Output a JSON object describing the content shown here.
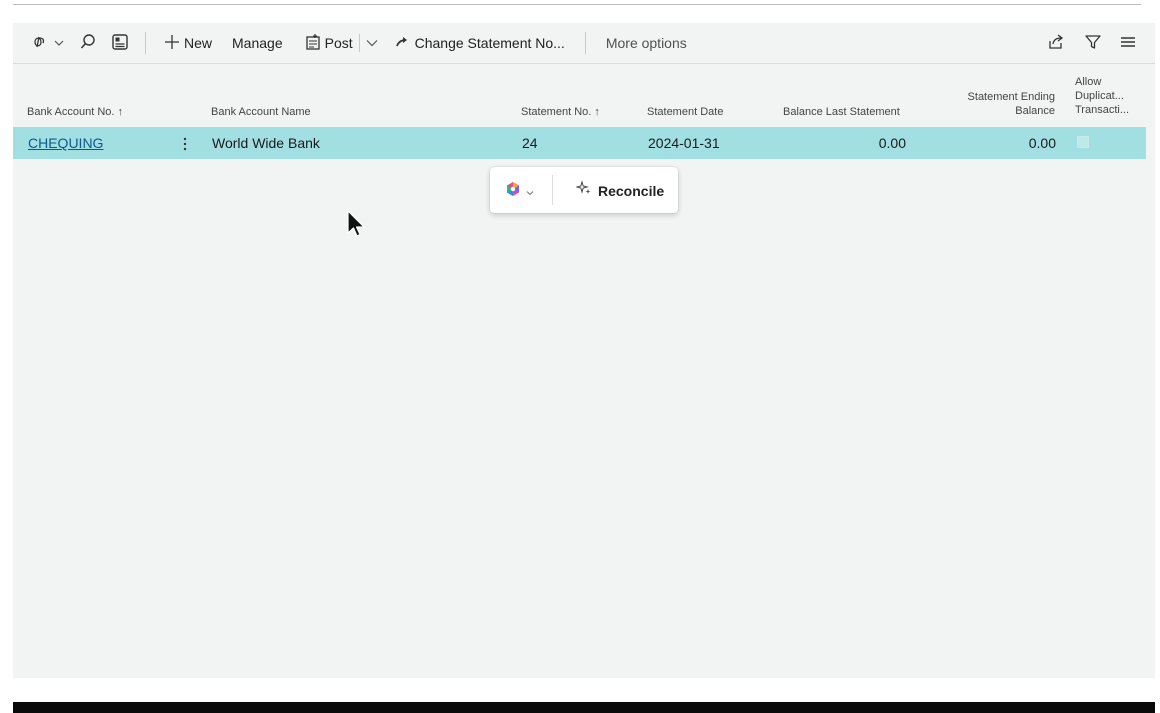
{
  "toolbar": {
    "new_label": "New",
    "manage_label": "Manage",
    "post_label": "Post",
    "change_statement_label": "Change Statement No...",
    "more_options_label": "More options"
  },
  "table": {
    "headers": {
      "bank_account_no": "Bank Account No. ↑",
      "bank_account_name": "Bank Account Name",
      "statement_no": "Statement No. ↑",
      "statement_date": "Statement Date",
      "balance_last_statement": "Balance Last Statement",
      "statement_ending_balance_1": "Statement Ending",
      "statement_ending_balance_2": "Balance",
      "allow_duplicate_1": "Allow",
      "allow_duplicate_2": "Duplicat...",
      "allow_duplicate_3": "Transacti..."
    },
    "rows": [
      {
        "bank_account_no": "CHEQUING",
        "bank_account_name": "World Wide Bank",
        "statement_no": "24",
        "statement_date": "2024-01-31",
        "balance_last_statement": "0.00",
        "statement_ending_balance": "0.00",
        "allow_duplicate": false
      }
    ]
  },
  "popup": {
    "reconcile_label": "Reconcile"
  },
  "icons": {
    "action_menu": "copilot-chevron-icon",
    "search": "search-icon",
    "layout": "layout-icon",
    "new": "plus-icon",
    "post": "post-icon",
    "change_statement": "arrow-icon",
    "share": "share-icon",
    "filter": "filter-icon",
    "list": "list-icon",
    "row_menu": "more-vertical-icon",
    "copilot": "copilot-icon",
    "reconcile": "sparkle-icon",
    "cursor": "mouse-pointer-icon"
  },
  "colors": {
    "selected_row": "#a2dfe3",
    "link": "#0b5a8a",
    "panel_bg": "#f2f4f4"
  }
}
